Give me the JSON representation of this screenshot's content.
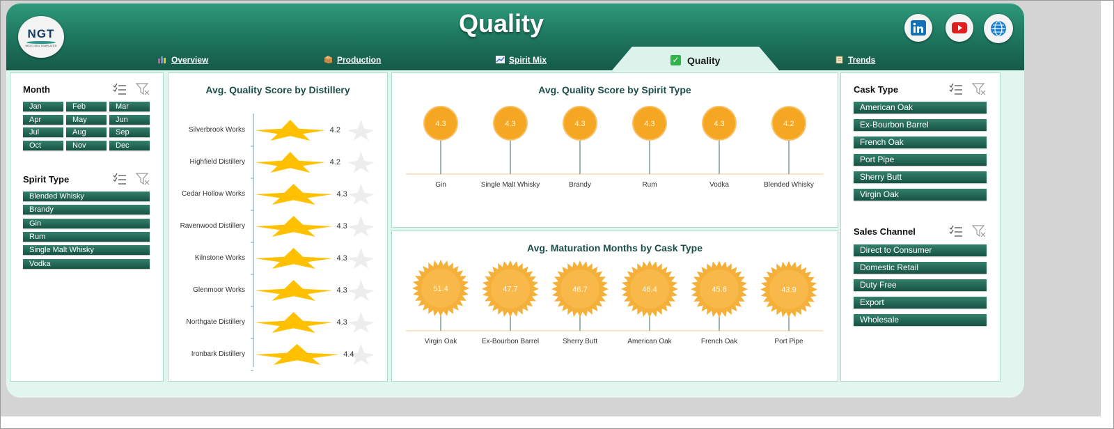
{
  "header": {
    "title": "Quality",
    "logo": {
      "text": "NGT",
      "subtext": "NEXT GEN TEMPLATES"
    },
    "nav": [
      {
        "label": "Overview",
        "icon": "bar-chart-icon"
      },
      {
        "label": "Production",
        "icon": "box-icon"
      },
      {
        "label": "Spirit Mix",
        "icon": "line-chart-icon"
      },
      {
        "label": "Quality",
        "icon": "checkbox-icon",
        "active": true
      },
      {
        "label": "Trends",
        "icon": "clipboard-icon"
      }
    ],
    "social": [
      "linkedin-icon",
      "youtube-icon",
      "globe-icon"
    ]
  },
  "left_slicers": {
    "month": {
      "title": "Month",
      "items": [
        "Jan",
        "Feb",
        "Mar",
        "Apr",
        "May",
        "Jun",
        "Jul",
        "Aug",
        "Sep",
        "Oct",
        "Nov",
        "Dec"
      ]
    },
    "spirit_type": {
      "title": "Spirit Type",
      "items": [
        "Blended Whisky",
        "Brandy",
        "Gin",
        "Rum",
        "Single Malt Whisky",
        "Vodka"
      ]
    }
  },
  "right_slicers": {
    "cask_type": {
      "title": "Cask Type",
      "items": [
        "American Oak",
        "Ex-Bourbon Barrel",
        "French Oak",
        "Port Pipe",
        "Sherry Butt",
        "Virgin Oak"
      ]
    },
    "sales_channel": {
      "title": "Sales Channel",
      "items": [
        "Direct to Consumer",
        "Domestic Retail",
        "Duty Free",
        "Export",
        "Wholesale"
      ]
    }
  },
  "colors": {
    "header_dark": "#155a48",
    "header_light": "#2f9a7c",
    "chip": "#1f6a56",
    "star": "#ffc000",
    "circle": "#f5a623",
    "sunburst": "#f5b03a",
    "panel_border": "#a8ddd0"
  },
  "chart_data": [
    {
      "type": "bar",
      "marker": "star",
      "orientation": "horizontal",
      "title": "Avg. Quality Score by Distillery",
      "categories": [
        "Silverbrook Works",
        "Highfield Distillery",
        "Cedar Hollow Works",
        "Ravenwood Distillery",
        "Kilnstone Works",
        "Glenmoor Works",
        "Northgate Distillery",
        "Ironbark Distillery"
      ],
      "values": [
        4.2,
        4.2,
        4.3,
        4.3,
        4.3,
        4.3,
        4.3,
        4.4
      ],
      "value_labels": [
        "4.2",
        "4.2",
        "4.3",
        "4.3",
        "4.3",
        "4.3",
        "4.3",
        "4.4"
      ],
      "xlim": [
        3.5,
        4.6
      ]
    },
    {
      "type": "lollipop",
      "title": "Avg. Quality Score by Spirit Type",
      "categories": [
        "Gin",
        "Single Malt Whisky",
        "Brandy",
        "Rum",
        "Vodka",
        "Blended Whisky"
      ],
      "values": [
        4.3,
        4.3,
        4.3,
        4.3,
        4.3,
        4.2
      ],
      "value_labels": [
        "4.3",
        "4.3",
        "4.3",
        "4.3",
        "4.3",
        "4.2"
      ],
      "ylim": [
        0,
        5
      ]
    },
    {
      "type": "lollipop",
      "marker": "sunburst",
      "title": "Avg. Maturation Months by Cask Type",
      "categories": [
        "Virgin Oak",
        "Ex-Bourbon Barrel",
        "Sherry Butt",
        "American Oak",
        "French Oak",
        "Port Pipe"
      ],
      "values": [
        51.4,
        47.7,
        46.7,
        46.4,
        45.6,
        43.9
      ],
      "value_labels": [
        "51.4",
        "47.7",
        "46.7",
        "46.4",
        "45.6",
        "43.9"
      ],
      "ylim": [
        0,
        60
      ]
    }
  ]
}
